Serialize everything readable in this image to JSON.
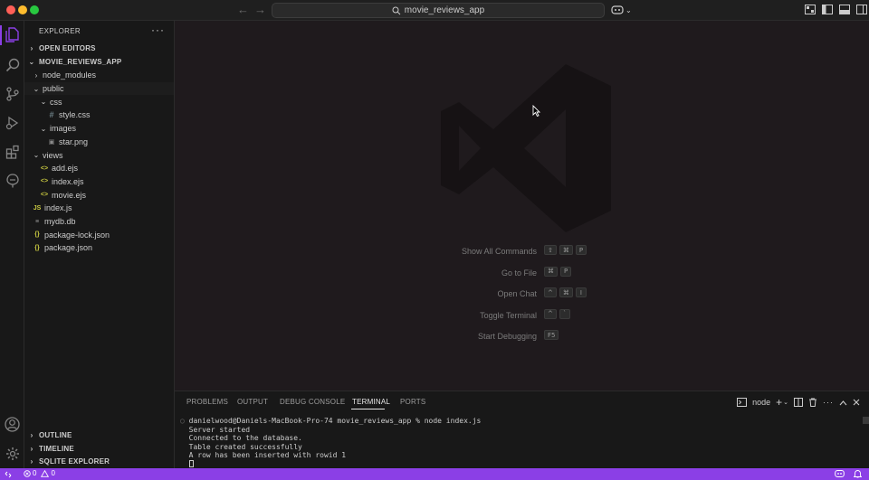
{
  "titlebar": {
    "search_text": "movie_reviews_app",
    "icons": [
      "back-arrow-icon",
      "forward-arrow-icon",
      "search-icon",
      "copilot-icon",
      "toggle-sidebar-icon",
      "toggle-panel-icon",
      "toggle-secondary-sidebar-icon",
      "customize-layout-icon"
    ]
  },
  "activity_bar": {
    "items": [
      "explorer-icon",
      "search-icon",
      "source-control-icon",
      "run-debug-icon",
      "extensions-icon",
      "sqlite-explorer-icon"
    ],
    "bottom_items": [
      "account-icon",
      "settings-icon"
    ]
  },
  "sidebar": {
    "header": "EXPLORER",
    "more": "···",
    "open_editors": "OPEN EDITORS",
    "project": "MOVIE_REVIEWS_APP",
    "tree": [
      {
        "label": "node_modules",
        "icon": "",
        "chevron": "›",
        "indent": 1
      },
      {
        "label": "public",
        "icon": "",
        "chevron": "⌄",
        "indent": 1
      },
      {
        "label": "css",
        "icon": "",
        "chevron": "⌄",
        "indent": 2
      },
      {
        "label": "style.css",
        "icon": "#",
        "chevron": "",
        "indent": 3
      },
      {
        "label": "images",
        "icon": "",
        "chevron": "⌄",
        "indent": 2
      },
      {
        "label": "star.png",
        "icon": "▣",
        "chevron": "",
        "indent": 3
      },
      {
        "label": "views",
        "icon": "",
        "chevron": "⌄",
        "indent": 1
      },
      {
        "label": "add.ejs",
        "icon": "<>",
        "chevron": "",
        "indent": 2
      },
      {
        "label": "index.ejs",
        "icon": "<>",
        "chevron": "",
        "indent": 2
      },
      {
        "label": "movie.ejs",
        "icon": "<>",
        "chevron": "",
        "indent": 2
      },
      {
        "label": "index.js",
        "icon": "JS",
        "chevron": "",
        "indent": 1
      },
      {
        "label": "mydb.db",
        "icon": "≡",
        "chevron": "",
        "indent": 1
      },
      {
        "label": "package-lock.json",
        "icon": "{}",
        "chevron": "",
        "indent": 1
      },
      {
        "label": "package.json",
        "icon": "{}",
        "chevron": "",
        "indent": 1
      }
    ],
    "outline": "OUTLINE",
    "timeline": "TIMELINE",
    "sqlite_explorer": "SQLITE EXPLORER"
  },
  "editor": {
    "shortcuts": [
      {
        "label": "Show All Commands",
        "keys": [
          "⇧",
          "⌘",
          "P"
        ]
      },
      {
        "label": "Go to File",
        "keys": [
          "⌘",
          "P"
        ]
      },
      {
        "label": "Open Chat",
        "keys": [
          "^",
          "⌘",
          "I"
        ]
      },
      {
        "label": "Toggle Terminal",
        "keys": [
          "^",
          "`"
        ]
      },
      {
        "label": "Start Debugging",
        "keys": [
          "F5"
        ]
      }
    ]
  },
  "panel": {
    "tabs": [
      "PROBLEMS",
      "OUTPUT",
      "DEBUG CONSOLE",
      "TERMINAL",
      "PORTS"
    ],
    "active_tab": "TERMINAL",
    "terminal_name": "node",
    "terminal_lines": [
      "danielwood@Daniels-MacBook-Pro-74 movie_reviews_app % node index.js",
      "Server started",
      "Connected to the database.",
      "Table created successfully",
      "A row has been inserted with rowid 1"
    ]
  },
  "statusbar": {
    "errors": "0",
    "warnings": "0",
    "accent_color": "#8b3fe6"
  }
}
